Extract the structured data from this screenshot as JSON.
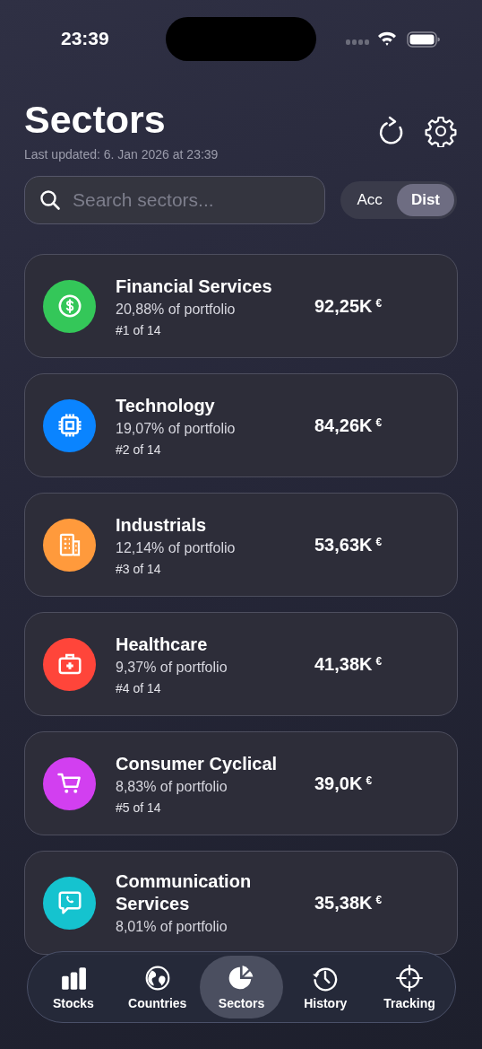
{
  "status_bar": {
    "time": "23:39"
  },
  "header": {
    "title": "Sectors",
    "subtitle": "Last updated: 6. Jan 2026 at 23:39"
  },
  "search": {
    "placeholder": "Search sectors..."
  },
  "toggle": [
    {
      "label": "Acc",
      "selected": false
    },
    {
      "label": "Dist",
      "selected": true
    }
  ],
  "sectors": [
    {
      "kind": "dollar",
      "color": "#34c759",
      "name": "Financial Services",
      "share": "20,88% of portfolio",
      "rank": "#1 of 14",
      "value": "92,25K",
      "currency": "€"
    },
    {
      "kind": "chip",
      "color": "#0a84ff",
      "name": "Technology",
      "share": "19,07% of portfolio",
      "rank": "#2 of 14",
      "value": "84,26K",
      "currency": "€"
    },
    {
      "kind": "building",
      "color": "#ff9a3c",
      "name": "Industrials",
      "share": "12,14% of portfolio",
      "rank": "#3 of 14",
      "value": "53,63K",
      "currency": "€"
    },
    {
      "kind": "medkit",
      "color": "#ff453a",
      "name": "Healthcare",
      "share": "9,37% of portfolio",
      "rank": "#4 of 14",
      "value": "41,38K",
      "currency": "€"
    },
    {
      "kind": "cart",
      "color": "#d23ff0",
      "name": "Consumer Cyclical",
      "share": "8,83% of portfolio",
      "rank": "#5 of 14",
      "value": "39,0K",
      "currency": "€"
    },
    {
      "kind": "chat",
      "color": "#15c3cf",
      "name": "Communication Services",
      "share": "8,01% of portfolio",
      "value": "35,38K",
      "currency": "€"
    }
  ],
  "tabs": [
    {
      "kind": "bars",
      "label": "Stocks",
      "selected": false
    },
    {
      "kind": "globe",
      "label": "Countries",
      "selected": false
    },
    {
      "kind": "pie",
      "label": "Sectors",
      "selected": true
    },
    {
      "kind": "history",
      "label": "History",
      "selected": false
    },
    {
      "kind": "target",
      "label": "Tracking",
      "selected": false
    }
  ]
}
